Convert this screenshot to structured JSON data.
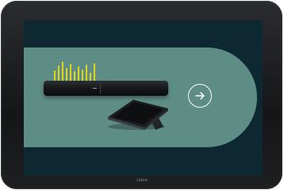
{
  "device": {
    "brand_label": "Jabra"
  },
  "screen": {
    "background_color": "#0d2830",
    "panel_color": "#5e8d85",
    "next_button_icon": "arrow-right-icon",
    "equalizer_color": "#e4d21a"
  }
}
